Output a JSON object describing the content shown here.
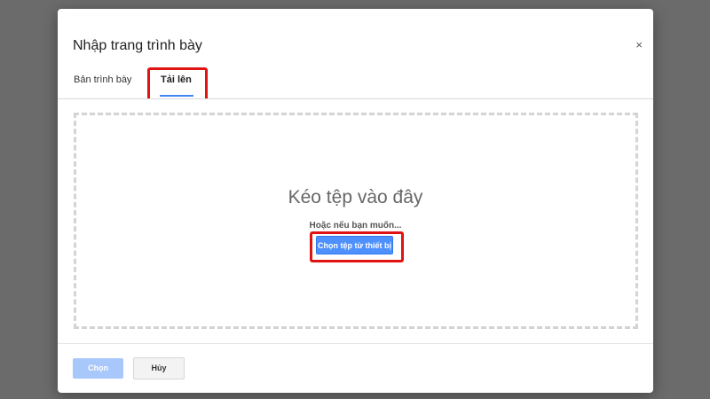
{
  "dialog": {
    "title": "Nhập trang trình bày",
    "close_icon": "close-icon",
    "close_glyph": "×"
  },
  "tabs": [
    {
      "label": "Bản trình bày",
      "active": false
    },
    {
      "label": "Tải lên",
      "active": true
    }
  ],
  "upload": {
    "heading": "Kéo tệp vào đây",
    "subtext": "Hoặc nếu bạn muốn...",
    "choose_button": "Chọn tệp từ thiết bị"
  },
  "footer": {
    "select_button": "Chọn",
    "select_disabled": true,
    "cancel_button": "Hủy"
  },
  "colors": {
    "accent": "#4d90fe",
    "highlight_annotation": "#e01313",
    "backdrop": "#6b6b6b"
  }
}
